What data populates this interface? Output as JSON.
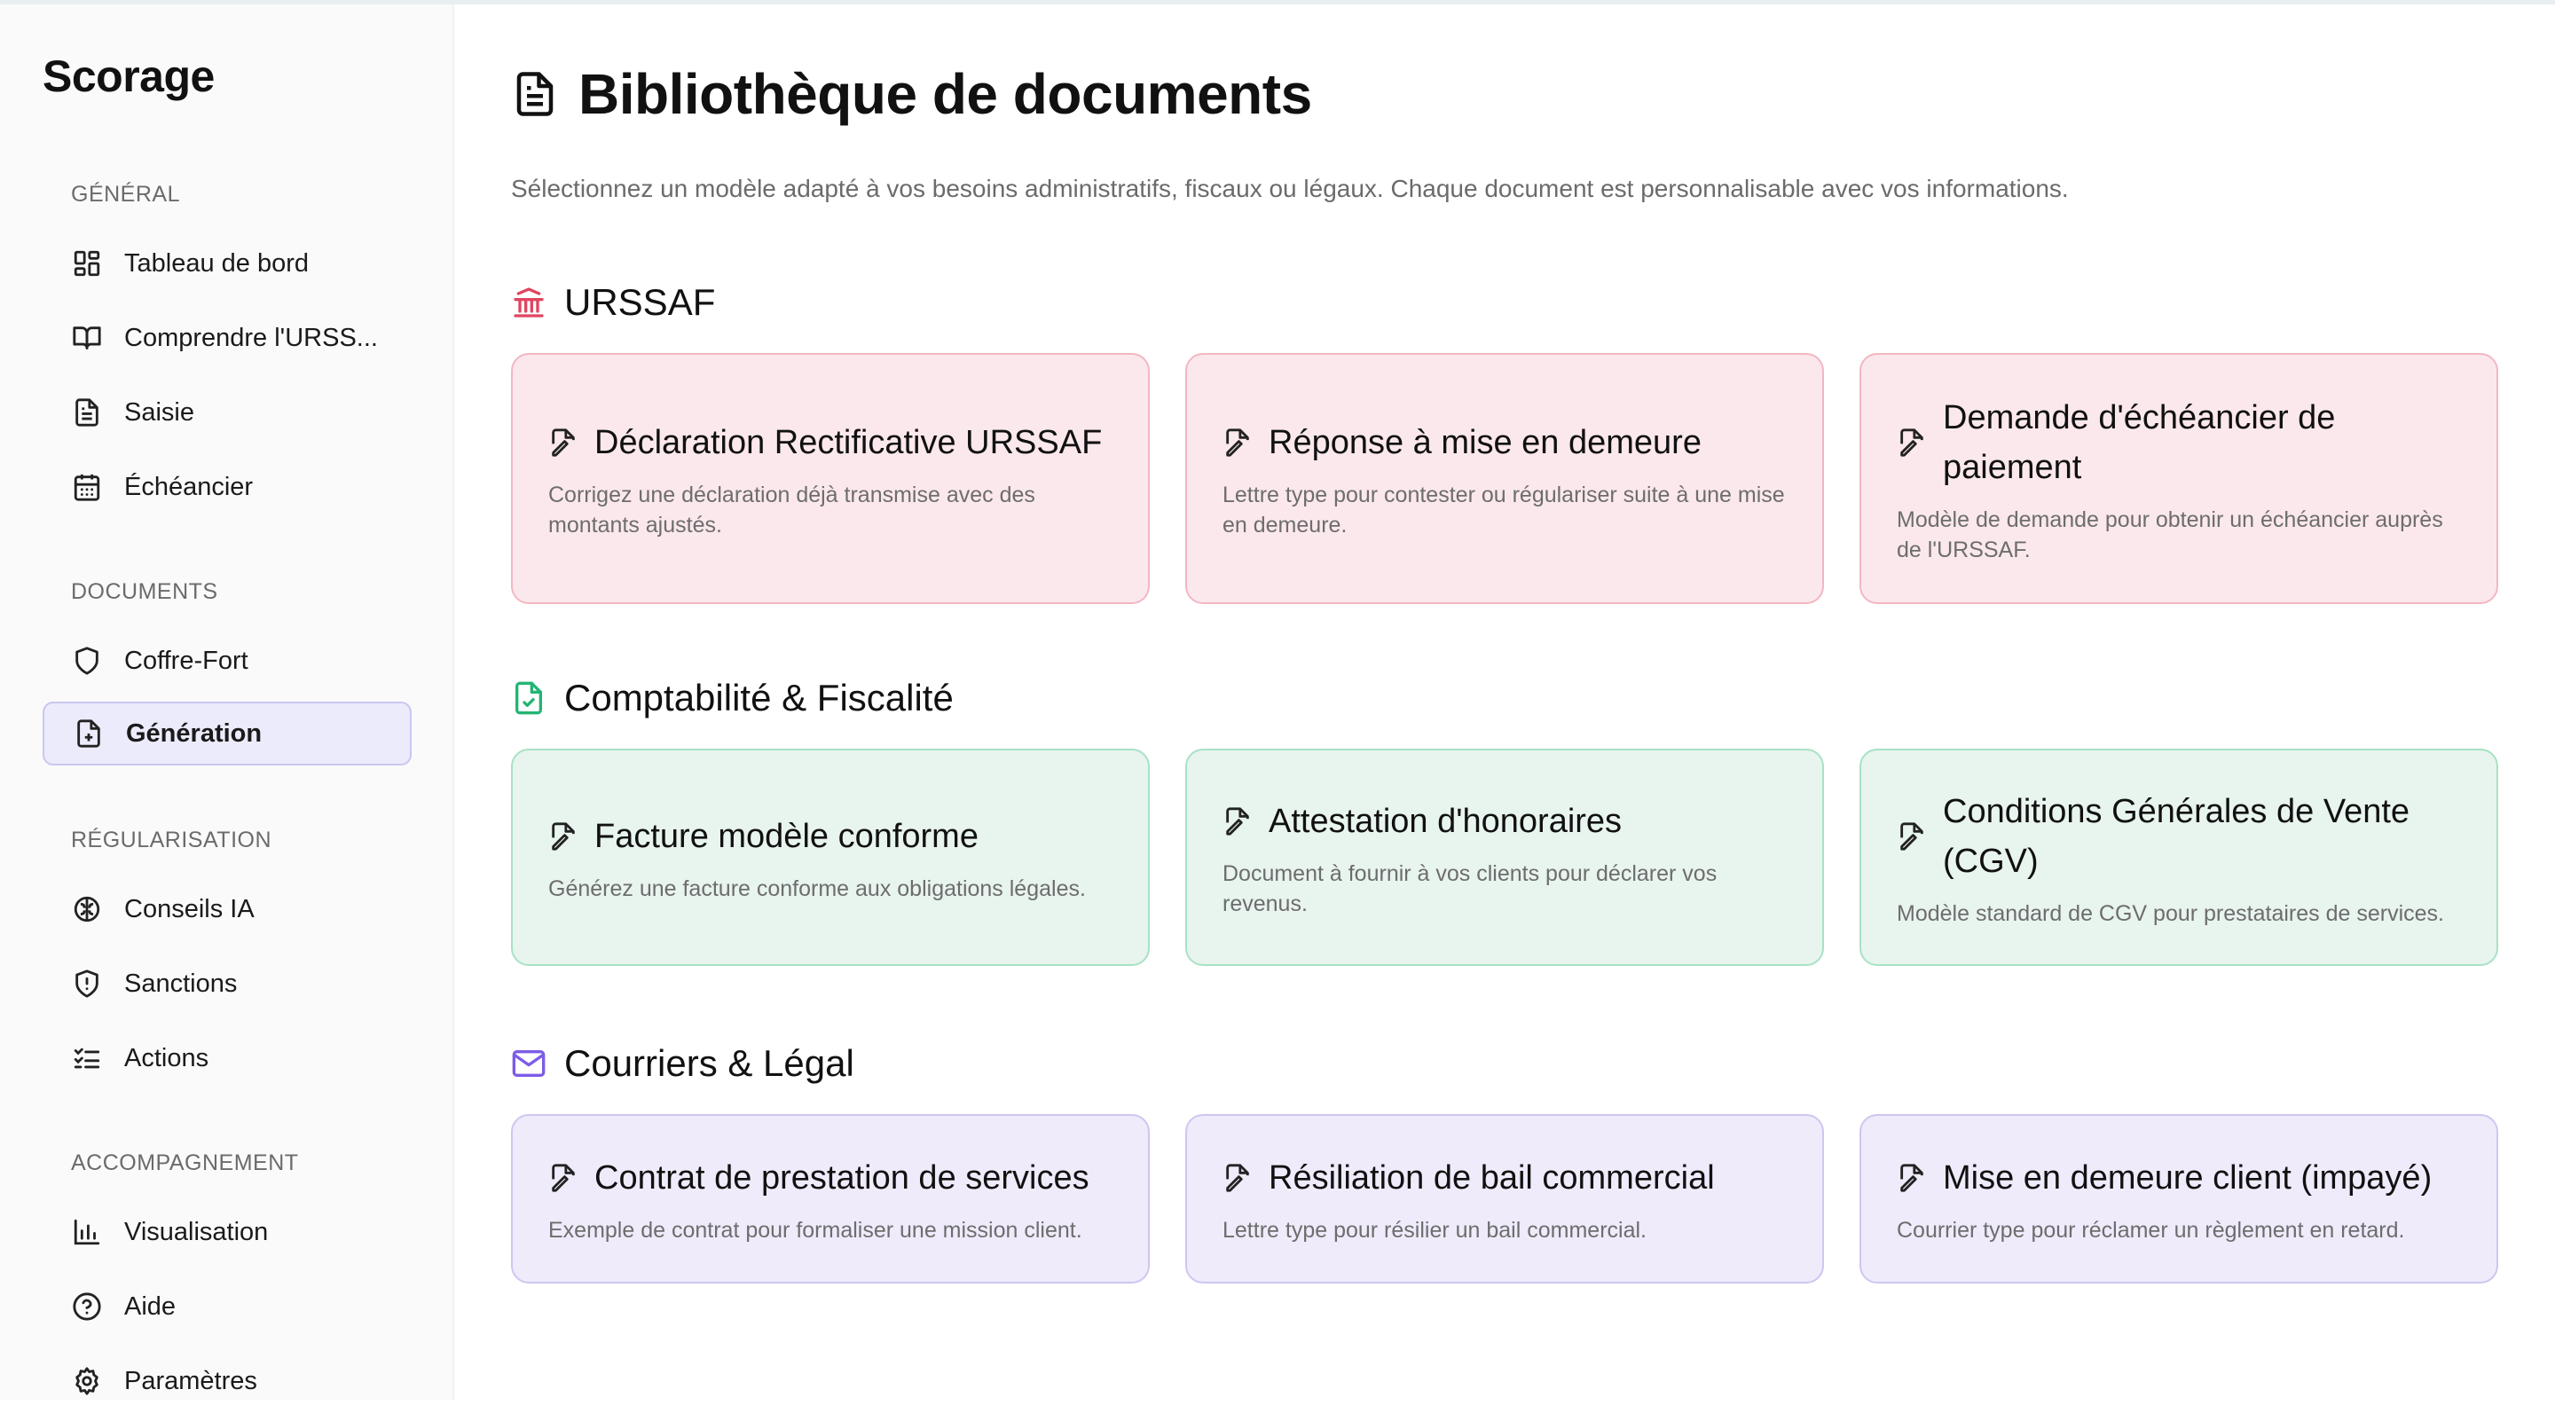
{
  "app": {
    "brand": "Scorage"
  },
  "sidebar": {
    "sections": [
      {
        "label": "GÉNÉRAL",
        "items": [
          {
            "label": "Tableau de bord",
            "icon": "dashboard-icon"
          },
          {
            "label": "Comprendre l'URSS...",
            "icon": "book-icon"
          },
          {
            "label": "Saisie",
            "icon": "document-icon"
          },
          {
            "label": "Échéancier",
            "icon": "calendar-icon"
          }
        ]
      },
      {
        "label": "DOCUMENTS",
        "items": [
          {
            "label": "Coffre-Fort",
            "icon": "shield-icon"
          },
          {
            "label": "Génération",
            "icon": "file-plus-icon",
            "active": true
          }
        ]
      },
      {
        "label": "RÉGULARISATION",
        "items": [
          {
            "label": "Conseils IA",
            "icon": "brain-icon"
          },
          {
            "label": "Sanctions",
            "icon": "shield-alert-icon"
          },
          {
            "label": "Actions",
            "icon": "checklist-icon"
          }
        ]
      },
      {
        "label": "ACCOMPAGNEMENT",
        "items": [
          {
            "label": "Visualisation",
            "icon": "bar-chart-icon"
          },
          {
            "label": "Aide",
            "icon": "help-circle-icon"
          },
          {
            "label": "Paramètres",
            "icon": "gear-icon"
          }
        ]
      }
    ]
  },
  "main": {
    "title": "Bibliothèque de documents",
    "subtitle": "Sélectionnez un modèle adapté à vos besoins administratifs, fiscaux ou légaux. Chaque document est personnalisable avec vos informations.",
    "categories": [
      {
        "name": "URSSAF",
        "icon": "bank-icon",
        "color": "#e0455f",
        "cards": [
          {
            "title": "Déclaration Rectificative URSSAF",
            "desc": "Corrigez une déclaration déjà transmise avec des montants ajustés."
          },
          {
            "title": "Réponse à mise en demeure",
            "desc": "Lettre type pour contester ou régulariser suite à une mise en demeure."
          },
          {
            "title": "Demande d'échéancier de paiement",
            "desc": "Modèle de demande pour obtenir un échéancier auprès de l'URSSAF."
          }
        ]
      },
      {
        "name": "Comptabilité & Fiscalité",
        "icon": "file-check-icon",
        "color": "#22b573",
        "cards": [
          {
            "title": "Facture modèle conforme",
            "desc": "Générez une facture conforme aux obligations légales."
          },
          {
            "title": "Attestation d'honoraires",
            "desc": "Document à fournir à vos clients pour déclarer vos revenus."
          },
          {
            "title": "Conditions Générales de Vente (CGV)",
            "desc": "Modèle standard de CGV pour prestataires de services."
          }
        ]
      },
      {
        "name": "Courriers & Légal",
        "icon": "mail-icon",
        "color": "#7c5ce6",
        "cards": [
          {
            "title": "Contrat de prestation de services",
            "desc": "Exemple de contrat pour formaliser une mission client."
          },
          {
            "title": "Résiliation de bail commercial",
            "desc": "Lettre type pour résilier un bail commercial."
          },
          {
            "title": "Mise en demeure client (impayé)",
            "desc": "Courrier type pour réclamer un règlement en retard."
          }
        ]
      }
    ]
  }
}
